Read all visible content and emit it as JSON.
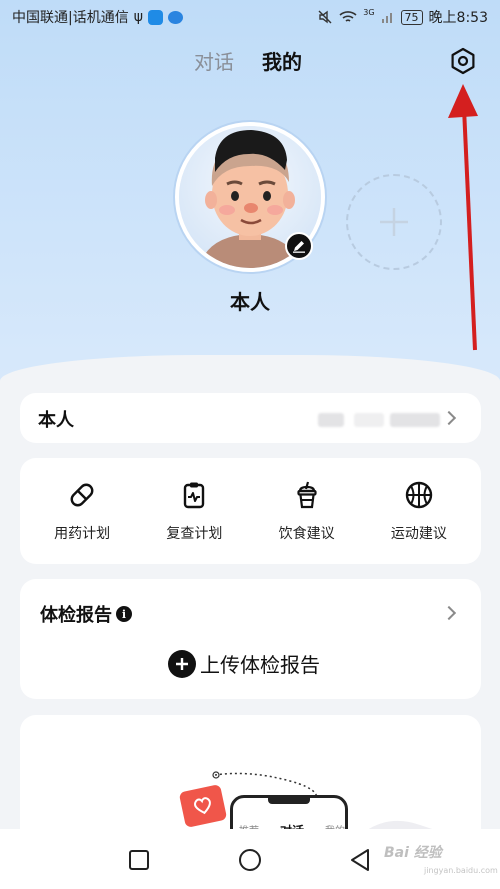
{
  "status_bar": {
    "carrier": "中国联通|话机通信",
    "usb_symbol": "ψ",
    "network_label": "3G",
    "battery": "75",
    "time": "晚上8:53"
  },
  "tabs": [
    {
      "label": "对话"
    },
    {
      "label": "我的"
    }
  ],
  "profile": {
    "name": "本人"
  },
  "member_card": {
    "name": "本人"
  },
  "plans": [
    {
      "label": "用药计划",
      "icon": "pill-icon"
    },
    {
      "label": "复查计划",
      "icon": "clipboard-pulse-icon"
    },
    {
      "label": "饮食建议",
      "icon": "drink-cup-icon"
    },
    {
      "label": "运动建议",
      "icon": "basketball-icon"
    }
  ],
  "report": {
    "title": "体检报告",
    "info_glyph": "i",
    "upload_label": "上传体检报告"
  },
  "promo_phone": {
    "tabs": [
      "推荐",
      "对话",
      "我的"
    ]
  },
  "watermark": {
    "text": "Bai 经验",
    "sub": "jingyan.baidu.com"
  },
  "colors": {
    "accent_red": "#d41f1f",
    "heart_card": "#f0564a",
    "background_top": "#bfdcf8"
  }
}
